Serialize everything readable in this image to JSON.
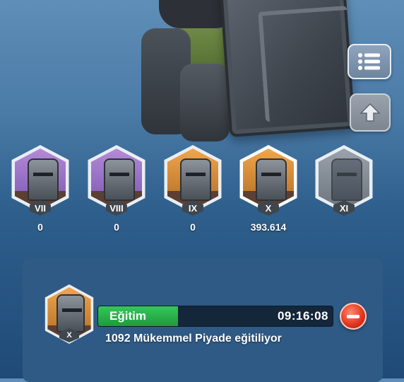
{
  "tiers": [
    {
      "roman": "VII",
      "count": "0",
      "bg": "purple"
    },
    {
      "roman": "VIII",
      "count": "0",
      "bg": "purple"
    },
    {
      "roman": "IX",
      "count": "0",
      "bg": "orange"
    },
    {
      "roman": "X",
      "count": "393.614",
      "bg": "orange",
      "selected": true
    },
    {
      "roman": "XI",
      "count": "",
      "bg": "gray",
      "locked": true
    }
  ],
  "training": {
    "unit_roman": "X",
    "label": "Eğitim",
    "time": "09:16:08",
    "progress_percent": 34,
    "description": "1092 Mükemmel Piyade eğitiliyor"
  },
  "icons": {
    "menu": "list-menu-icon",
    "up": "arrow-up-icon",
    "cancel": "minus-circle-icon"
  },
  "colors": {
    "progress": "#2dbb4f",
    "cancel": "#e0321c"
  }
}
